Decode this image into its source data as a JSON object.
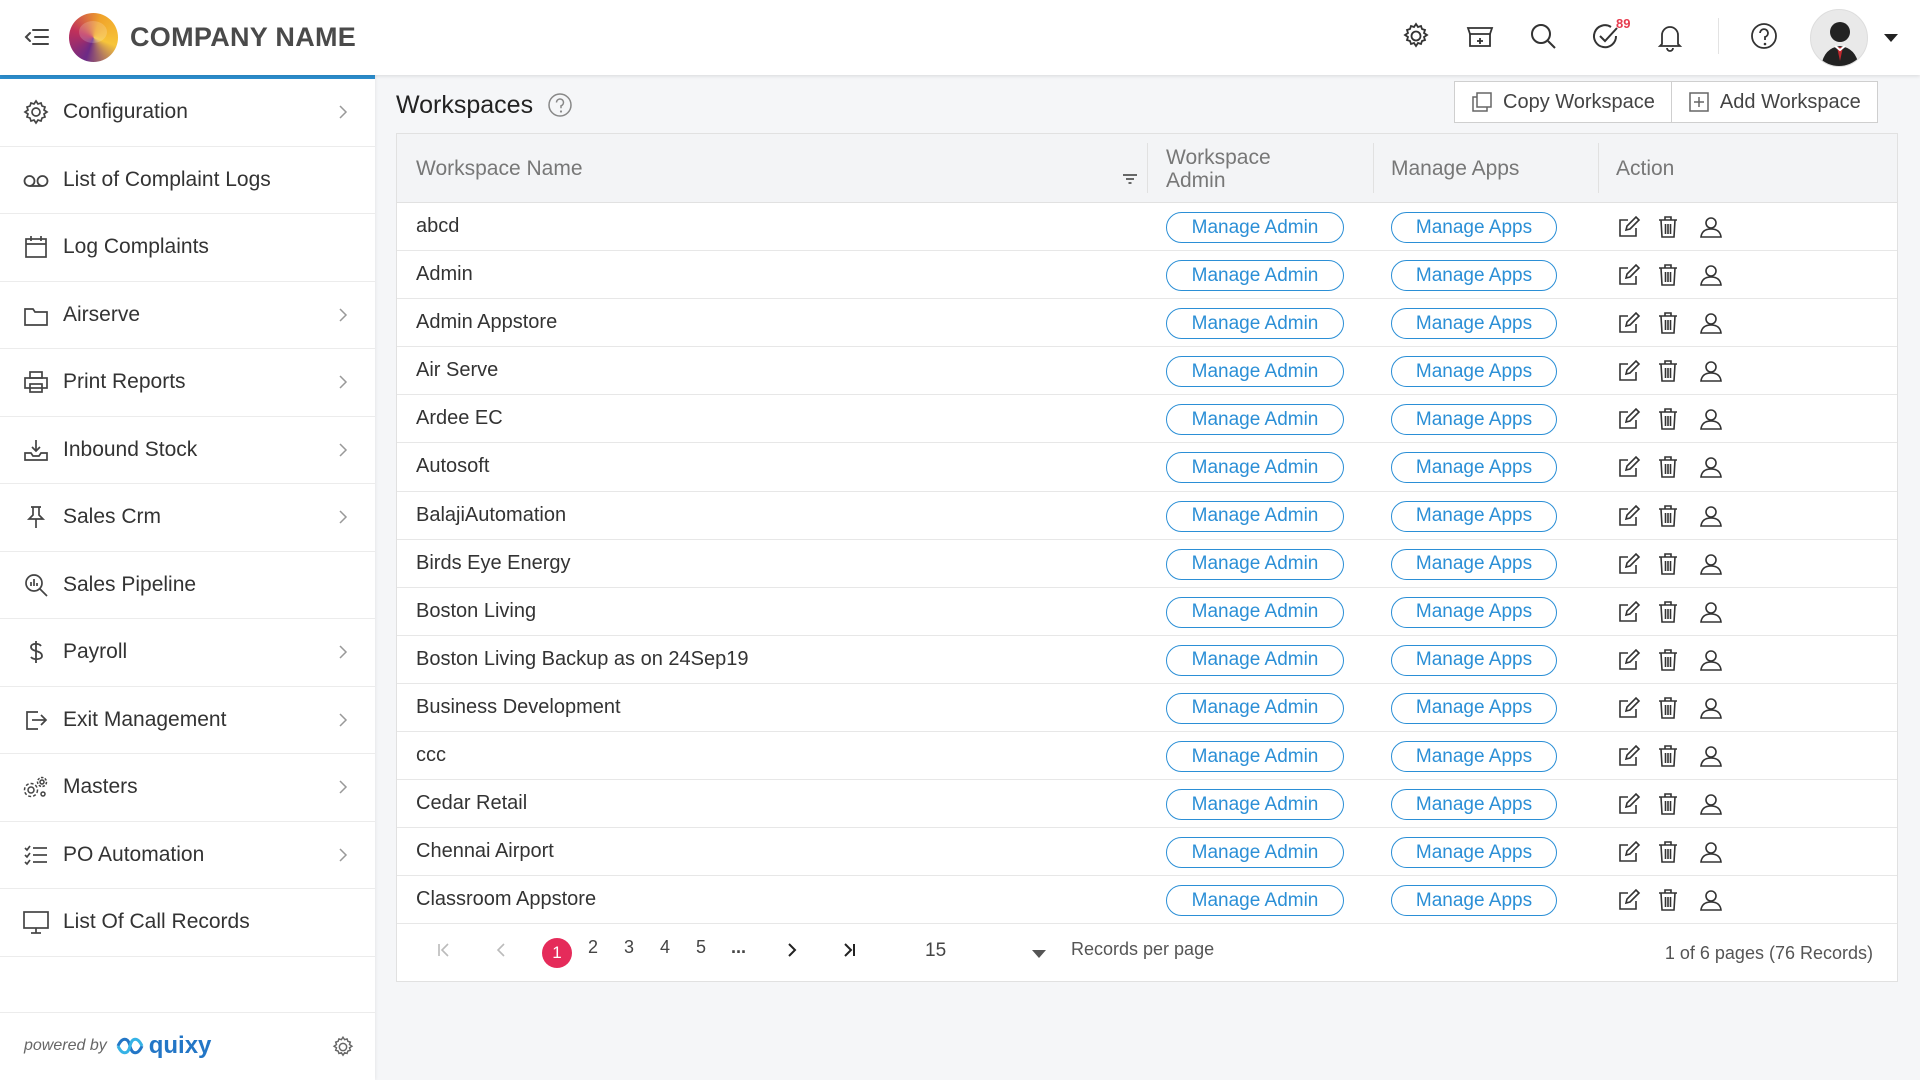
{
  "header": {
    "brand": "COMPANY NAME",
    "notification_badge": "89"
  },
  "sidebar": {
    "items": [
      {
        "label": "Configuration",
        "icon": "gear-icon",
        "chevron": true
      },
      {
        "label": "List of Complaint Logs",
        "icon": "voicemail-icon",
        "chevron": false
      },
      {
        "label": "Log Complaints",
        "icon": "calendar-icon",
        "chevron": false
      },
      {
        "label": "Airserve",
        "icon": "folder-icon",
        "chevron": true
      },
      {
        "label": "Print Reports",
        "icon": "printer-icon",
        "chevron": true
      },
      {
        "label": "Inbound Stock",
        "icon": "inbox-icon",
        "chevron": true
      },
      {
        "label": "Sales Crm",
        "icon": "pin-icon",
        "chevron": true
      },
      {
        "label": "Sales Pipeline",
        "icon": "search-chart-icon",
        "chevron": false
      },
      {
        "label": "Payroll",
        "icon": "dollar-icon",
        "chevron": true
      },
      {
        "label": "Exit Management",
        "icon": "exit-icon",
        "chevron": true
      },
      {
        "label": "Masters",
        "icon": "gears-icon",
        "chevron": true
      },
      {
        "label": "PO Automation",
        "icon": "checklist-icon",
        "chevron": true
      },
      {
        "label": "List Of Call Records",
        "icon": "monitor-icon",
        "chevron": false
      }
    ],
    "powered_by": "powered by",
    "powered_brand": "quixy"
  },
  "main": {
    "title": "Workspaces",
    "copy_button": "Copy Workspace",
    "add_button": "Add Workspace",
    "columns": [
      "Workspace Name",
      "Workspace Admin",
      "Manage Apps",
      "Action"
    ],
    "manage_admin_label": "Manage Admin",
    "manage_apps_label": "Manage Apps",
    "rows": [
      "abcd",
      "Admin",
      "Admin Appstore",
      "Air Serve",
      "Ardee EC",
      "Autosoft",
      "BalajiAutomation",
      "Birds Eye Energy",
      "Boston Living",
      "Boston Living Backup as on 24Sep19",
      "Business Development",
      "ccc",
      "Cedar Retail",
      "Chennai Airport",
      "Classroom Appstore"
    ]
  },
  "pagination": {
    "pages": [
      "1",
      "2",
      "3",
      "4",
      "5",
      "..."
    ],
    "current": "1",
    "per_page": "15",
    "per_page_label": "Records per page",
    "summary": "1 of 6 pages (76 Records)"
  },
  "colors": {
    "accent": "#2b8fd6",
    "active_page": "#e52b5a",
    "sidebar_top_border": "#2c8fcf"
  }
}
